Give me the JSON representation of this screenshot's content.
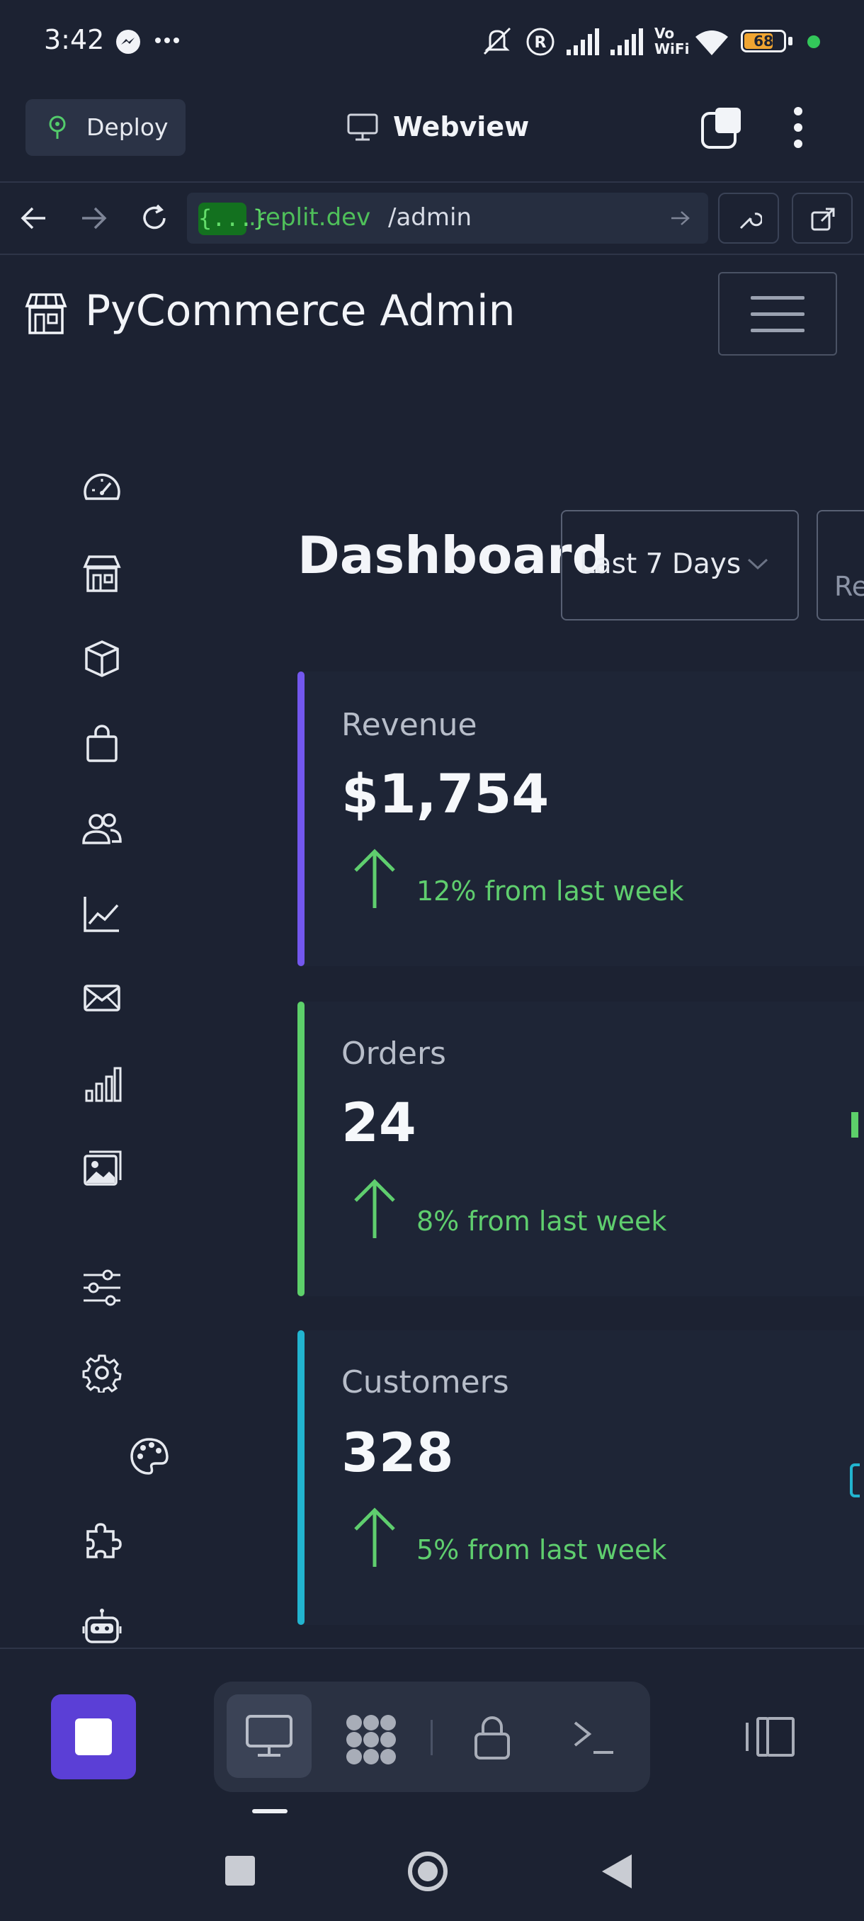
{
  "status_bar": {
    "time": "3:42",
    "battery": "68",
    "network_labels": [
      "Vo",
      "WiFi"
    ]
  },
  "top_bar": {
    "deploy_label": "Deploy",
    "title": "Webview"
  },
  "url_bar": {
    "token": "{...}",
    "host": ".replit.dev",
    "path": "/admin"
  },
  "app": {
    "title": "PyCommerce Admin"
  },
  "sidebar": {
    "items": [
      {
        "icon": "speedometer-icon"
      },
      {
        "icon": "store-icon"
      },
      {
        "icon": "box-icon"
      },
      {
        "icon": "shopping-bag-icon"
      },
      {
        "icon": "users-icon"
      },
      {
        "icon": "line-chart-icon"
      },
      {
        "icon": "envelope-icon"
      },
      {
        "icon": "bar-chart-icon"
      },
      {
        "icon": "images-icon"
      },
      {
        "icon": "sliders-icon"
      },
      {
        "icon": "gear-icon"
      },
      {
        "icon": "palette-icon"
      },
      {
        "icon": "puzzle-icon"
      },
      {
        "icon": "robot-icon"
      }
    ]
  },
  "dashboard": {
    "title": "Dashboard",
    "range_selected": "Last 7 Days",
    "next_control_partial": "Re",
    "stats": [
      {
        "label": "Revenue",
        "value": "$1,754",
        "change": "12% from last week",
        "color": "#7357ee"
      },
      {
        "label": "Orders",
        "value": "24",
        "change": "8% from last week",
        "color": "#5dd06a"
      },
      {
        "label": "Customers",
        "value": "328",
        "change": "5% from last week",
        "color": "#22b4cf"
      }
    ]
  },
  "colors": {
    "background": "#1c2232",
    "accent_purple": "#5b3fd6",
    "positive_green": "#5fce6e"
  }
}
